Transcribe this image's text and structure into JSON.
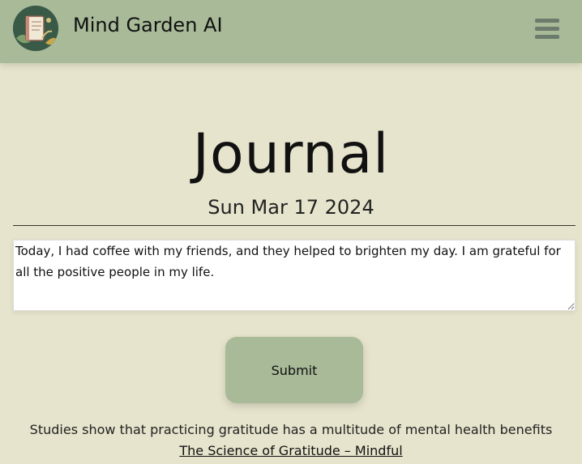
{
  "header": {
    "app_title": "Mind Garden AI",
    "logo_icon": "journal-notebook-logo-icon",
    "menu_icon": "hamburger-menu-icon"
  },
  "main": {
    "title": "Journal",
    "date": "Sun Mar 17 2024",
    "entry_text": "Today, I had coffee with my friends, and they helped to brighten my day. I am grateful for all the positive people in my life.",
    "submit_label": "Submit"
  },
  "footer": {
    "info_text": "Studies show that practicing gratitude has a multitude of mental health benefits",
    "link_text": "The Science of Gratitude – Mindful"
  },
  "colors": {
    "background": "#e6e4cc",
    "header": "#a8ba98",
    "button": "#a8ba98",
    "menu_icon": "#6b7b6c"
  }
}
